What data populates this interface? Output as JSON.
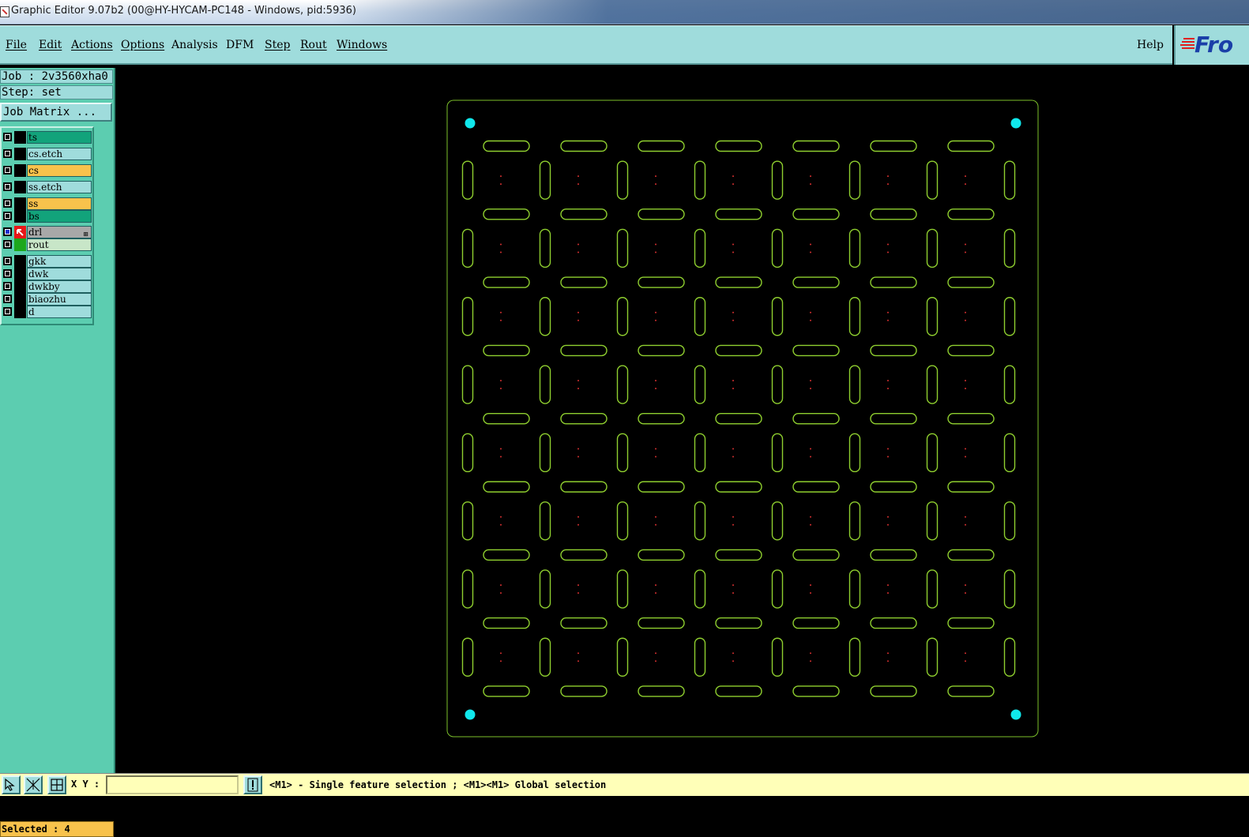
{
  "window": {
    "title": "Graphic Editor 9.07b2 (00@HY-HYCAM-PC148 - Windows, pid:5936)"
  },
  "menubar": {
    "items": [
      "File",
      "Edit",
      "Actions",
      "Options",
      "Analysis",
      "DFM",
      "Step",
      "Rout",
      "Windows"
    ],
    "help": "Help"
  },
  "logo": {
    "text": "Fro"
  },
  "info": {
    "job": "Job : 2v3560xha0",
    "step": "Step: set",
    "job_matrix": "Job Matrix ..."
  },
  "layers": [
    {
      "name": "ts",
      "color": "#12a37b",
      "swatch": "#000000",
      "active": false
    },
    {
      "name": "cs.etch",
      "color": "#9fdcdc",
      "swatch": "#000000",
      "active": false
    },
    {
      "name": "cs",
      "color": "#f8c24c",
      "swatch": "#000000",
      "active": false
    },
    {
      "name": "ss.etch",
      "color": "#9fdcdc",
      "swatch": "#000000",
      "active": false
    },
    {
      "name": "ss",
      "color": "#f8c24c",
      "swatch": "#000000",
      "active": false
    },
    {
      "name": "bs",
      "color": "#12a37b",
      "swatch": "#000000",
      "active": false
    },
    {
      "name": "drl",
      "color": "#a8a8a8",
      "swatch": "#e81818",
      "active": true,
      "work_icon": "arrow-icon",
      "extra": "⊞"
    },
    {
      "name": "rout",
      "color": "#c8e6c8",
      "swatch": "#1ca81c",
      "active": false
    },
    {
      "name": "gkk",
      "color": "#9fdcdc",
      "swatch": "#000000",
      "active": false
    },
    {
      "name": "dwk",
      "color": "#9fdcdc",
      "swatch": "#000000",
      "active": false
    },
    {
      "name": "dwkby",
      "color": "#9fdcdc",
      "swatch": "#000000",
      "active": false
    },
    {
      "name": "biaozhu",
      "color": "#9fdcdc",
      "swatch": "#000000",
      "active": false
    },
    {
      "name": "d",
      "color": "#9fdcdc",
      "swatch": "#000000",
      "active": false
    }
  ],
  "selected": "Selected : 4",
  "statusbar": {
    "xy_label": "X Y :",
    "xy_value": "",
    "hint": "<M1> - Single feature selection ; <M1><M1> Global selection",
    "buttons": [
      "cursor-icon",
      "cross-cursor-icon",
      "grid-snap-icon"
    ],
    "alert_icon": "exclamation-icon"
  },
  "colors": {
    "slot": "#8fcf2f",
    "border": "#7bbf2a",
    "fiducial": "#10e8ec",
    "drill_dot": "#d43030",
    "canvas": "#000000"
  },
  "board": {
    "rows": 8,
    "cols": 7
  }
}
